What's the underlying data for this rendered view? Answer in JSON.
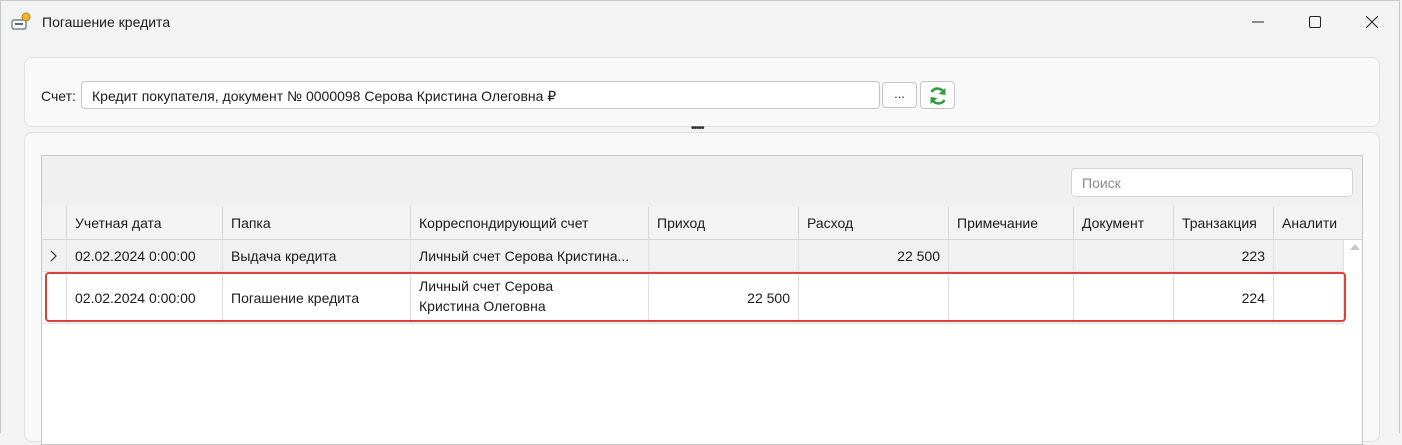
{
  "window": {
    "title": "Погашение кредита"
  },
  "account": {
    "label": "Счет:",
    "value": "Кредит покупателя, документ № 0000098 Серова Кристина Олеговна ₽",
    "browse_label": "..."
  },
  "grid": {
    "search_placeholder": "Поиск",
    "columns": [
      "Учетная дата",
      "Папка",
      "Корреспондирующий счет",
      "Приход",
      "Расход",
      "Примечание",
      "Документ",
      "Транзакция",
      "Аналити"
    ],
    "rows": [
      {
        "date": "02.02.2024 0:00:00",
        "folder": "Выдача кредита",
        "corr_account": "Личный счет Серова Кристина...",
        "income": "",
        "expense": "22 500",
        "note": "",
        "document": "",
        "transaction": "223",
        "analytics": ""
      },
      {
        "date": "02.02.2024 0:00:00",
        "folder": "Погашение кредита",
        "corr_account_line1": "Личный счет Серова",
        "corr_account_line2": "Кристина Олеговна",
        "income": "22 500",
        "expense": "",
        "note": "",
        "document": "",
        "transaction": "224",
        "analytics": ""
      }
    ]
  },
  "colors": {
    "highlight": "#d9413a",
    "refresh_icon": "#2e9e3e"
  }
}
